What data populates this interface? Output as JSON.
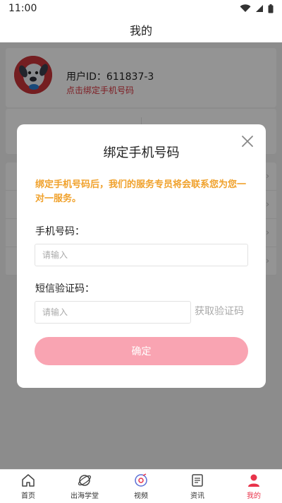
{
  "status_bar": {
    "time": "11:00",
    "icons": [
      "wifi-icon",
      "signal-icon",
      "battery-icon"
    ]
  },
  "header": {
    "title": "我的"
  },
  "profile": {
    "user_id": "用户ID：611837-3",
    "bind_link": "点击绑定手机号码"
  },
  "modal": {
    "title": "绑定手机号码",
    "description": "绑定手机号码后，我们的服务专员将会联系您为您一对一服务。",
    "phone_label": "手机号码：",
    "phone_placeholder": "请输入",
    "phone_value": "",
    "code_label": "短信验证码：",
    "code_placeholder": "请输入",
    "code_value": "",
    "send_code_label": "获取验证码",
    "confirm_label": "确定"
  },
  "tabbar": {
    "items": [
      {
        "label": "首页",
        "icon": "home-icon",
        "active": false
      },
      {
        "label": "出海学堂",
        "icon": "planet-icon",
        "active": false
      },
      {
        "label": "视频",
        "icon": "video-disc-icon",
        "active": false
      },
      {
        "label": "资讯",
        "icon": "news-icon",
        "active": false
      },
      {
        "label": "我的",
        "icon": "user-icon",
        "active": true
      }
    ]
  },
  "colors": {
    "accent_red": "#e8334a",
    "link_red": "#d9343f",
    "notice_orange": "#f0a12b",
    "confirm_pink": "#f9a4b2"
  }
}
